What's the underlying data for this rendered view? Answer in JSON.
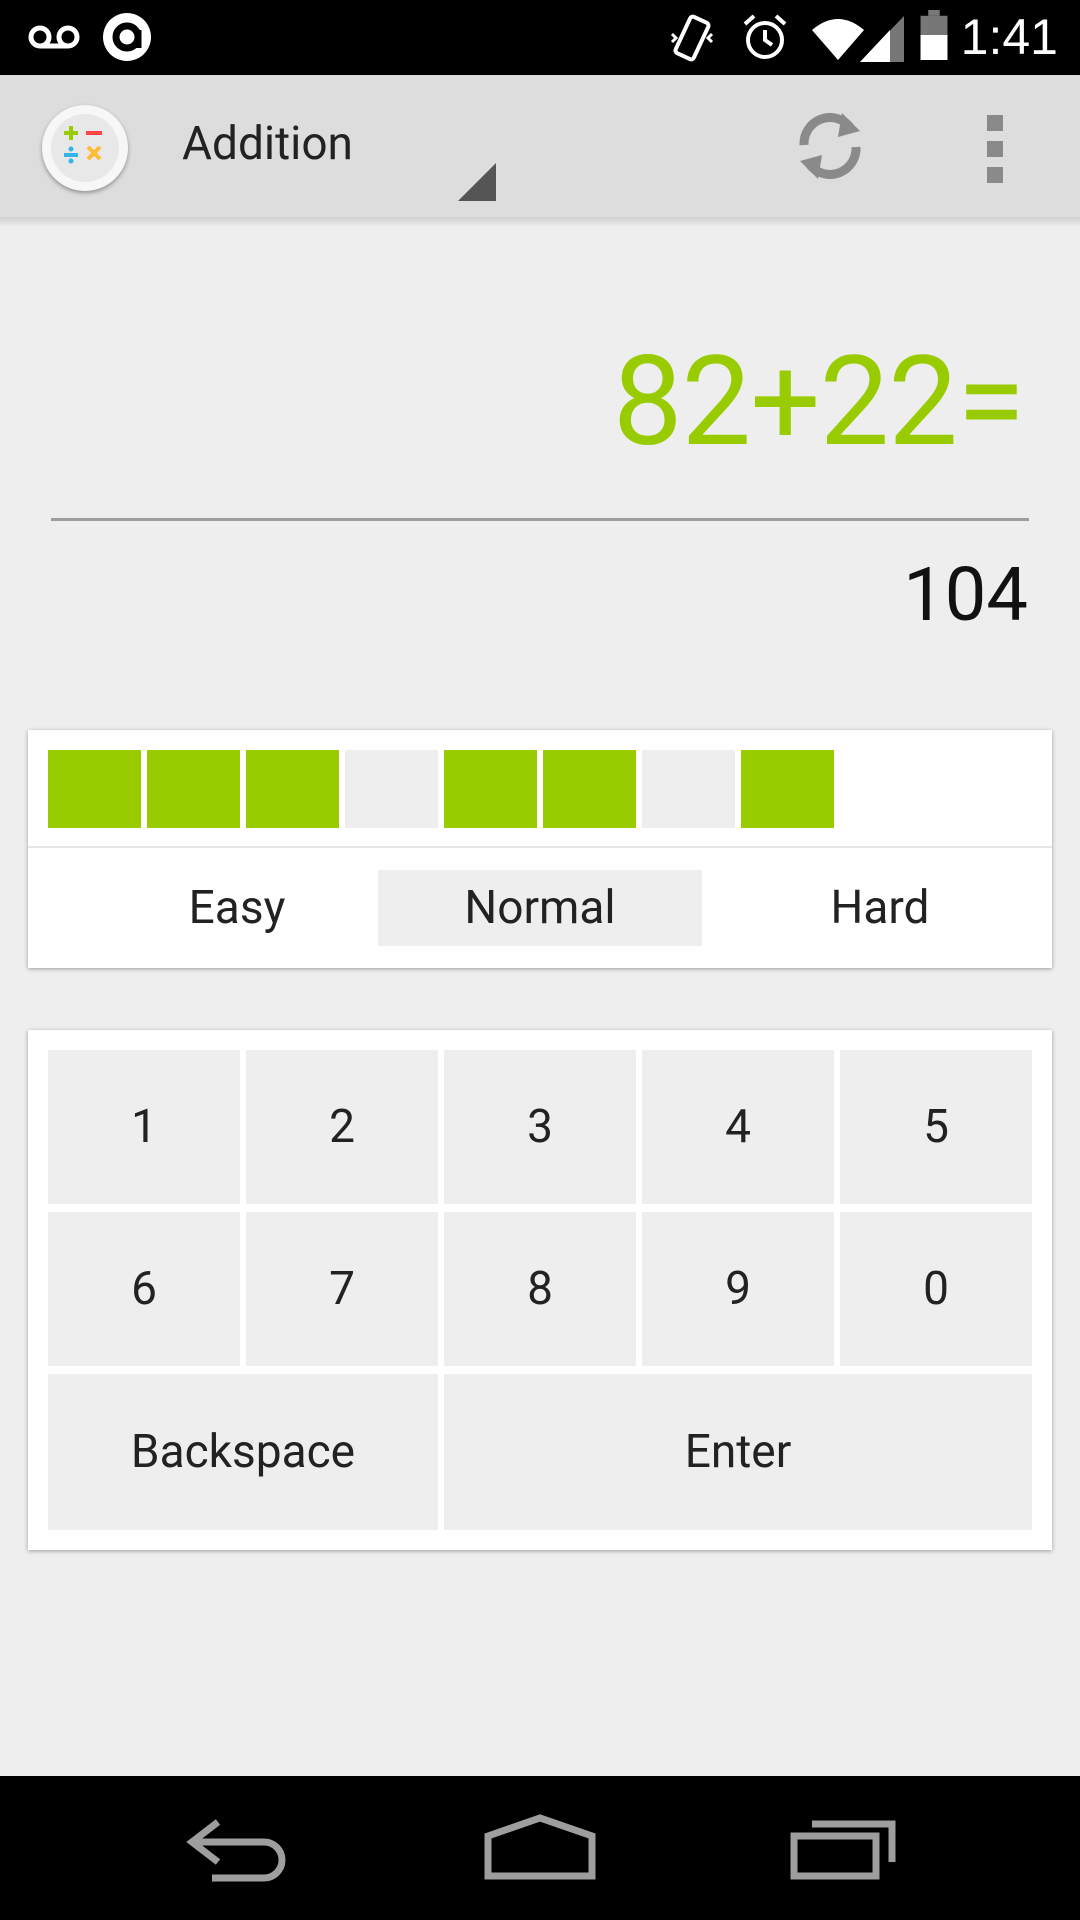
{
  "status_bar": {
    "time": "1:41",
    "icons": [
      "voicemail-icon",
      "app-notification-icon",
      "vibrate-icon",
      "alarm-icon",
      "wifi-icon",
      "signal-icon",
      "battery-icon"
    ]
  },
  "action_bar": {
    "title": "Addition",
    "icons": [
      "app-logo-icon",
      "spinner-triangle-icon",
      "refresh-icon",
      "overflow-menu-icon"
    ]
  },
  "problem": {
    "equation": "82+22=",
    "answer": "104"
  },
  "progress": {
    "cells": [
      "correct",
      "correct",
      "correct",
      "empty",
      "correct",
      "correct",
      "empty",
      "correct",
      "none",
      "none"
    ],
    "colors": {
      "correct": "#99cc00",
      "empty": "#eeeeee",
      "none": "#ffffff"
    }
  },
  "difficulty": {
    "options": [
      "Easy",
      "Normal",
      "Hard"
    ],
    "selected": "Normal"
  },
  "keypad": {
    "row1": [
      "1",
      "2",
      "3",
      "4",
      "5"
    ],
    "row2": [
      "6",
      "7",
      "8",
      "9",
      "0"
    ],
    "backspace": "Backspace",
    "enter": "Enter"
  },
  "nav_bar": {
    "icons": [
      "back-icon",
      "home-icon",
      "recents-icon"
    ]
  },
  "colors": {
    "accent": "#99cc00",
    "background": "#eeeeee",
    "action_bar": "#dddddd"
  }
}
